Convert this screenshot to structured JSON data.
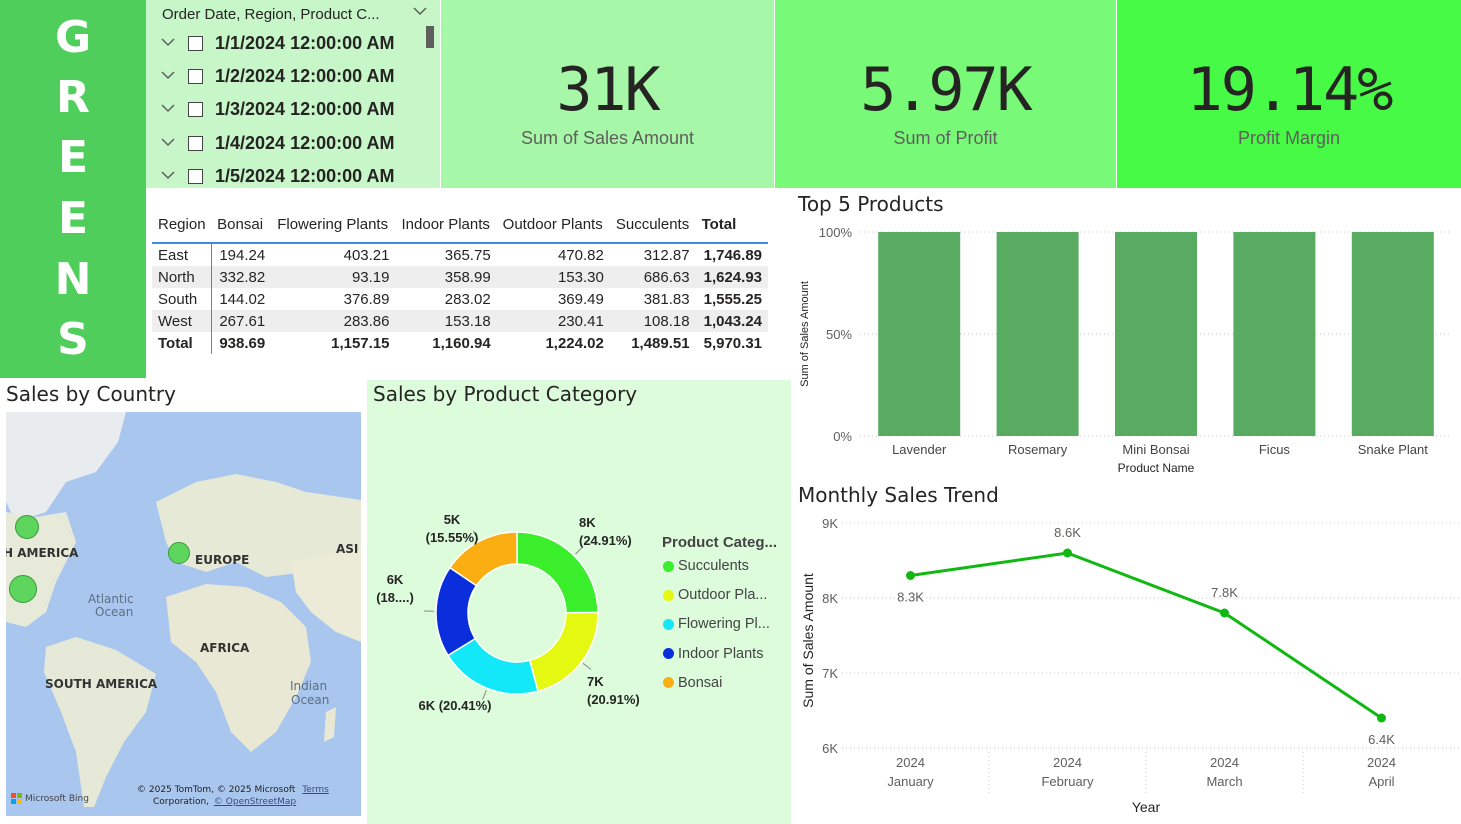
{
  "logo": {
    "letters": [
      "G",
      "R",
      "E",
      "E",
      "N",
      "S"
    ]
  },
  "slicer": {
    "header": "Order Date, Region, Product C...",
    "items": [
      "1/1/2024 12:00:00 AM",
      "1/2/2024 12:00:00 AM",
      "1/3/2024 12:00:00 AM",
      "1/4/2024 12:00:00 AM",
      "1/5/2024 12:00:00 AM"
    ]
  },
  "kpis": [
    {
      "value": "31K",
      "caption": "Sum of Sales Amount",
      "color": "#a6f8a8"
    },
    {
      "value": "5.97K",
      "caption": "Sum of Profit",
      "color": "#78fa78"
    },
    {
      "value": "19.14%",
      "caption": "Profit Margin",
      "color": "#46fa46"
    }
  ],
  "matrix": {
    "headers": [
      "Region",
      "Bonsai",
      "Flowering Plants",
      "Indoor Plants",
      "Outdoor Plants",
      "Succulents",
      "Total"
    ],
    "rows": [
      [
        "East",
        "194.24",
        "403.21",
        "365.75",
        "470.82",
        "312.87",
        "1,746.89"
      ],
      [
        "North",
        "332.82",
        "93.19",
        "358.99",
        "153.30",
        "686.63",
        "1,624.93"
      ],
      [
        "South",
        "144.02",
        "376.89",
        "283.02",
        "369.49",
        "381.83",
        "1,555.25"
      ],
      [
        "West",
        "267.61",
        "283.86",
        "153.18",
        "230.41",
        "108.18",
        "1,043.24"
      ]
    ],
    "total": [
      "Total",
      "938.69",
      "1,157.15",
      "1,160.94",
      "1,224.02",
      "1,489.51",
      "5,970.31"
    ]
  },
  "map": {
    "title": "Sales by Country",
    "labels": {
      "north_america": "H AMERICA",
      "europe": "EUROPE",
      "asia": "ASI",
      "atlantic": "Atlantic",
      "ocean": "Ocean",
      "africa": "AFRICA",
      "south_america": "SOUTH AMERICA",
      "indian": "Indian",
      "indian_ocean": "Ocean"
    },
    "bubbles": 3,
    "bubble_color": "#5ed65e",
    "attribution": "© 2025 TomTom, © 2025 Microsoft",
    "terms": "Terms",
    "corporation": "Corporation,",
    "osm": "© OpenStreetMap",
    "bing": "Microsoft Bing"
  },
  "chart_data": [
    {
      "type": "bar",
      "title": "Top 5 Products",
      "xlabel": "Product Name",
      "ylabel": "Sum of Sales Amount",
      "categories": [
        "Lavender",
        "Rosemary",
        "Mini Bonsai",
        "Ficus",
        "Snake Plant"
      ],
      "values": [
        100,
        100,
        100,
        100,
        100
      ],
      "ylim": [
        0,
        100
      ],
      "yticks": [
        "0%",
        "50%",
        "100%"
      ],
      "color": "#5aab62",
      "grid": true
    },
    {
      "type": "pie",
      "title": "Sales by Product Category",
      "legend_title": "Product Categ...",
      "slices": [
        {
          "name": "Succulents",
          "legend": "Succulents",
          "value": 24.91,
          "label": "8K",
          "pct": "(24.91%)",
          "color": "#3aee2c"
        },
        {
          "name": "Outdoor Plants",
          "legend": "Outdoor Pla...",
          "value": 20.91,
          "label": "7K",
          "pct": "(20.91%)",
          "color": "#e4f812"
        },
        {
          "name": "Flowering Plants",
          "legend": "Flowering Pl...",
          "value": 20.41,
          "label": "6K (20.41%)",
          "pct": "",
          "color": "#12e8f8"
        },
        {
          "name": "Indoor Plants",
          "legend": "Indoor Plants",
          "value": 18.22,
          "label": "6K",
          "pct": "(18....)",
          "color": "#0a2edc"
        },
        {
          "name": "Bonsai",
          "legend": "Bonsai",
          "value": 15.55,
          "label": "5K",
          "pct": "(15.55%)",
          "color": "#fbae12"
        }
      ],
      "legend_position": "right"
    },
    {
      "type": "line",
      "title": "Monthly Sales Trend",
      "xlabel": "Year",
      "ylabel": "Sum of Sales Amount",
      "categories": [
        [
          "2024",
          "January"
        ],
        [
          "2024",
          "February"
        ],
        [
          "2024",
          "March"
        ],
        [
          "2024",
          "April"
        ]
      ],
      "values": [
        8300,
        8600,
        7800,
        6400
      ],
      "value_labels": [
        "8.3K",
        "8.6K",
        "7.8K",
        "6.4K"
      ],
      "ylim": [
        6000,
        9000
      ],
      "yticks": [
        "6K",
        "7K",
        "8K",
        "9K"
      ],
      "color": "#12b812",
      "grid": true
    }
  ]
}
